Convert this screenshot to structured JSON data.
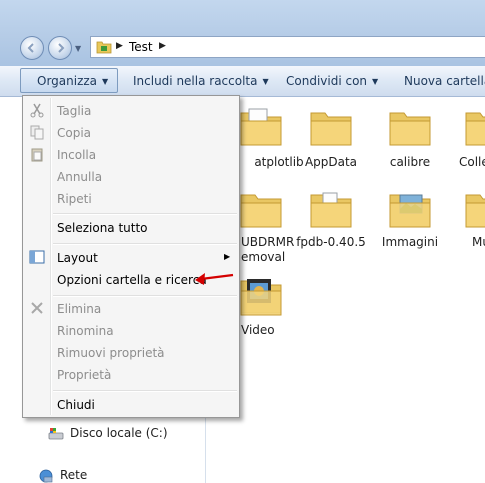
{
  "address": {
    "path": [
      "Test"
    ]
  },
  "toolbar": {
    "organize": "Organizza",
    "include": "Includi nella raccolta",
    "share": "Condividi con",
    "new_folder": "Nuova cartella"
  },
  "menu": {
    "items": [
      {
        "label": "Taglia",
        "enabled": false,
        "icon": "scissors-icon"
      },
      {
        "label": "Copia",
        "enabled": false,
        "icon": "copy-icon"
      },
      {
        "label": "Incolla",
        "enabled": false,
        "icon": "paste-icon"
      },
      {
        "label": "Annulla",
        "enabled": false
      },
      {
        "label": "Ripeti",
        "enabled": false
      },
      {
        "label": "Seleziona tutto",
        "enabled": true
      },
      {
        "label": "Layout",
        "enabled": true,
        "icon": "layout-icon",
        "submenu": true
      },
      {
        "label": "Opzioni cartella e ricerca",
        "enabled": true
      },
      {
        "label": "Elimina",
        "enabled": false,
        "icon": "delete-icon"
      },
      {
        "label": "Rinomina",
        "enabled": false
      },
      {
        "label": "Rimuovi proprietà",
        "enabled": false
      },
      {
        "label": "Proprietà",
        "enabled": false
      },
      {
        "label": "Chiudi",
        "enabled": true
      }
    ]
  },
  "nav_pane": {
    "local_disk": "Disco locale (C:)",
    "network": "Rete"
  },
  "files": [
    {
      "name": "atplotlib"
    },
    {
      "name": "AppData"
    },
    {
      "name": "calibre"
    },
    {
      "name": "Colle"
    },
    {
      "name": "UBDRMR"
    },
    {
      "name": "fpdb-0.40.5"
    },
    {
      "name": "Immagini"
    },
    {
      "name": "Mu"
    },
    {
      "name": "Video"
    }
  ],
  "file_extra": {
    "ubdrmr_line2": "emoval"
  },
  "colors": {
    "accent": "#cfdcee",
    "menu_bg": "#f5f5f5",
    "annotation_arrow": "#d40000"
  }
}
